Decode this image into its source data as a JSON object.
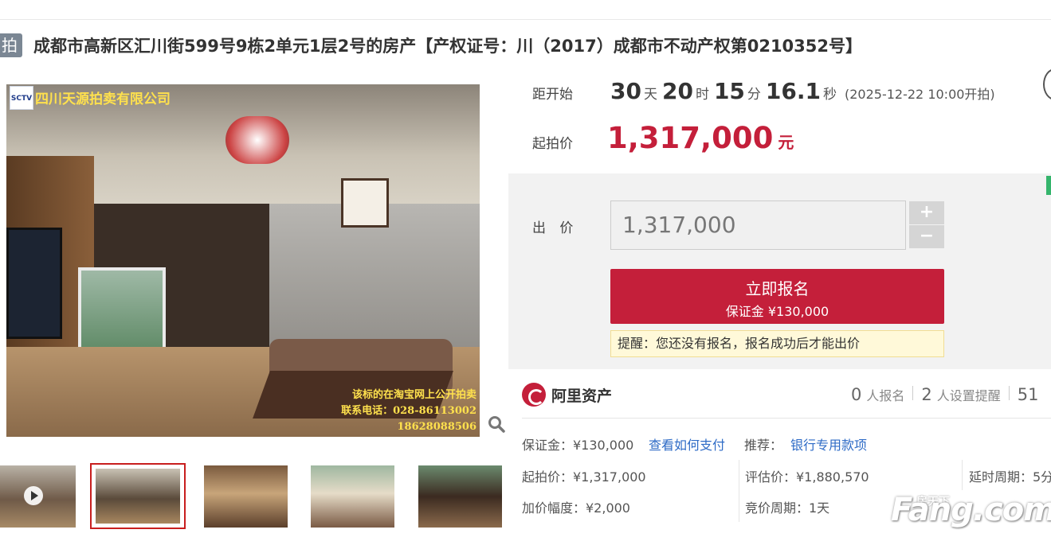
{
  "header": {
    "tag": "拍",
    "title": "成都市高新区汇川街599号9栋2单元1层2号的房产【产权证号：川（2017）成都市不动产权第0210352号】"
  },
  "gallery": {
    "logo_text": "SCTV",
    "company": "四川天源拍卖有限公司",
    "overlay_lines": [
      "该标的在淘宝网上公开拍卖",
      "联系电话：028-86113002",
      "18628088506"
    ],
    "thumbnails": 5,
    "active_thumbnail": 2
  },
  "countdown": {
    "label": "距开始",
    "days": "30",
    "days_unit": "天",
    "hours": "20",
    "hours_unit": "时",
    "minutes": "15",
    "minutes_unit": "分",
    "seconds": "16.1",
    "seconds_unit": "秒",
    "start_time": "(2025-12-22 10:00开拍)"
  },
  "start_price": {
    "label": "起拍价",
    "value": "1,317,000",
    "unit": "元"
  },
  "bid": {
    "label": "出 价",
    "input_value": "1,317,000",
    "plus": "+",
    "minus": "−"
  },
  "register": {
    "title": "立即报名",
    "deposit": "保证金 ¥130,000"
  },
  "tip": "提醒：您还没有报名，报名成功后才能出价",
  "ali": {
    "name": "阿里资产",
    "registrants_count": "0",
    "registrants_label": "人报名",
    "reminders_count": "2",
    "reminders_label": "人设置提醒",
    "views_count": "51"
  },
  "details": {
    "deposit": "保证金：¥130,000",
    "how_to_pay": "查看如何支付",
    "recommend": "推荐：",
    "bank_loan": "银行专用款项",
    "start_price": "起拍价：¥1,317,000",
    "appraisal": "评估价：¥1,880,570",
    "delay_period": "延时周期：5分",
    "increment": "加价幅度：¥2,000",
    "bidding_period": "竞价周期：1天"
  },
  "watermark": {
    "main": "Fang.com",
    "small": "房天下"
  },
  "colors": {
    "accent": "#c41f3a",
    "link": "#2e6bc6",
    "panel_bg": "#f2f2f2",
    "tip_bg": "#fff9d9"
  }
}
